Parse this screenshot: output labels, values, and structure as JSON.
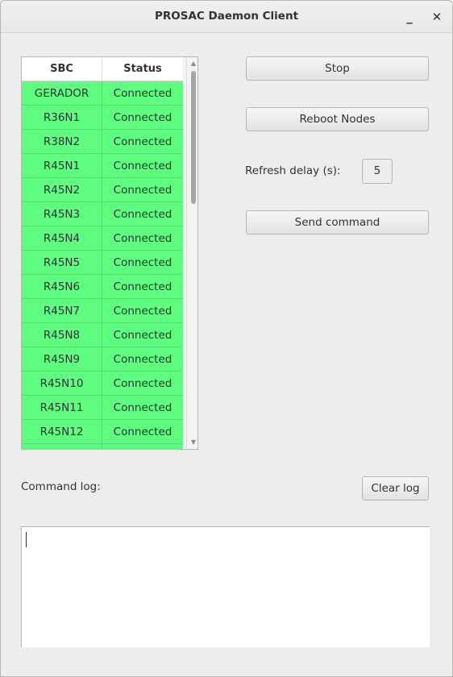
{
  "window": {
    "title": "PROSAC Daemon Client",
    "minimize_glyph": "_",
    "close_glyph": "✕"
  },
  "table": {
    "columns": [
      "SBC",
      "Status"
    ],
    "rows": [
      {
        "sbc": "GERADOR",
        "status": "Connected"
      },
      {
        "sbc": "R36N1",
        "status": "Connected"
      },
      {
        "sbc": "R38N2",
        "status": "Connected"
      },
      {
        "sbc": "R45N1",
        "status": "Connected"
      },
      {
        "sbc": "R45N2",
        "status": "Connected"
      },
      {
        "sbc": "R45N3",
        "status": "Connected"
      },
      {
        "sbc": "R45N4",
        "status": "Connected"
      },
      {
        "sbc": "R45N5",
        "status": "Connected"
      },
      {
        "sbc": "R45N6",
        "status": "Connected"
      },
      {
        "sbc": "R45N7",
        "status": "Connected"
      },
      {
        "sbc": "R45N8",
        "status": "Connected"
      },
      {
        "sbc": "R45N9",
        "status": "Connected"
      },
      {
        "sbc": "R45N10",
        "status": "Connected"
      },
      {
        "sbc": "R45N11",
        "status": "Connected"
      },
      {
        "sbc": "R45N12",
        "status": "Connected"
      },
      {
        "sbc": "",
        "status": ""
      }
    ],
    "connected_color": "#5efd80"
  },
  "controls": {
    "stop_label": "Stop",
    "reboot_label": "Reboot Nodes",
    "refresh_label": "Refresh delay (s):",
    "refresh_value": "5",
    "send_label": "Send command"
  },
  "log": {
    "label": "Command log:",
    "clear_label": "Clear log",
    "content": ""
  }
}
